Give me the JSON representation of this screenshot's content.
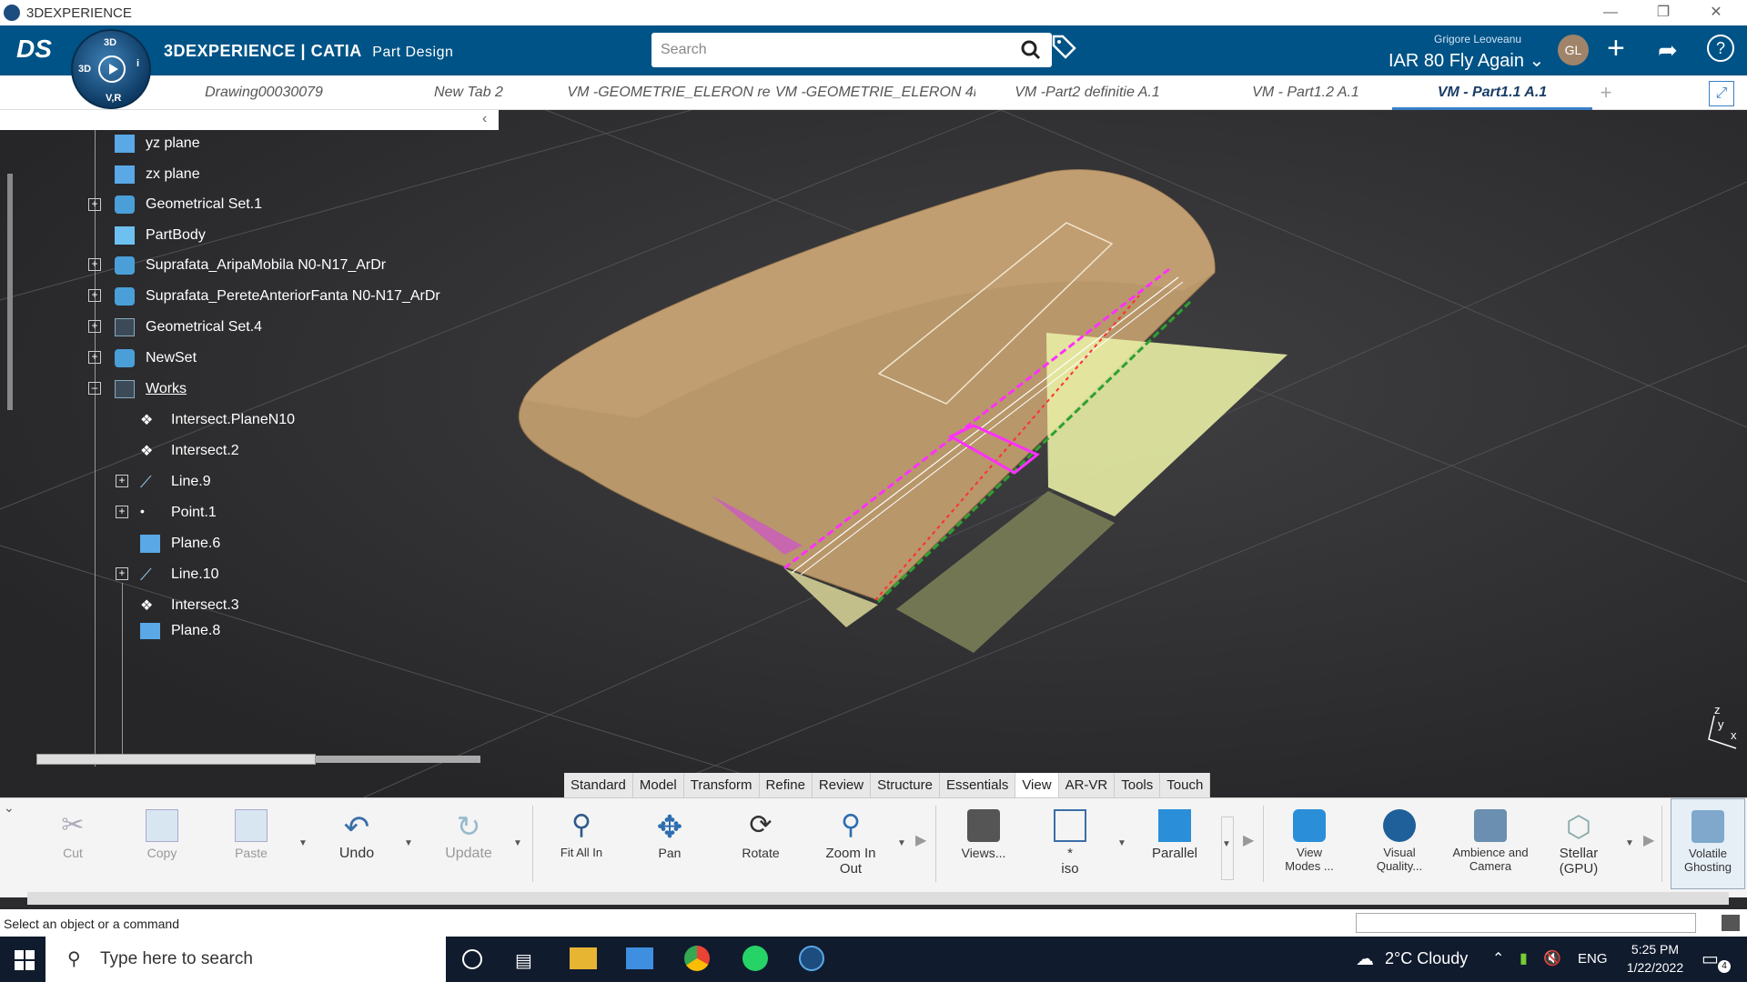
{
  "window": {
    "title": "3DEXPERIENCE"
  },
  "header": {
    "brand": "3DEXPERIENCE | CATIA",
    "app": "Part Design",
    "user_name": "Grigore Leoveanu",
    "project": "IAR 80 Fly Again",
    "avatar": "GL",
    "compass": {
      "top": "3D",
      "bottom": "V,R",
      "right": "i",
      "left": "3D"
    }
  },
  "search": {
    "placeholder": "Search"
  },
  "tabs": [
    {
      "label": "Drawing00030079"
    },
    {
      "label": "New Tab 2"
    },
    {
      "label": "VM -GEOMETRIE_ELERON re"
    },
    {
      "label": "VM -GEOMETRIE_ELERON 4n"
    },
    {
      "label": "VM -Part2 definitie A.1"
    },
    {
      "label": "VM - Part1.2 A.1"
    },
    {
      "label": "VM - Part1.1 A.1"
    },
    {
      "label": "+"
    }
  ],
  "tree": [
    {
      "label": "yz plane",
      "icon": "plane-icon"
    },
    {
      "label": "zx plane",
      "icon": "plane-icon"
    },
    {
      "label": "Geometrical Set.1",
      "icon": "geoset-icon"
    },
    {
      "label": "PartBody",
      "icon": "partbody-icon"
    },
    {
      "label": "Suprafata_AripaMobila N0-N17_ArDr",
      "icon": "geoset-icon"
    },
    {
      "label": "Suprafata_PereteAnteriorFanta N0-N17_ArDr",
      "icon": "geoset-icon"
    },
    {
      "label": "Geometrical Set.4",
      "icon": "geoset-icon"
    },
    {
      "label": "NewSet",
      "icon": "geoset-icon"
    },
    {
      "label": "Works",
      "icon": "geoset-icon"
    },
    {
      "label": "Intersect.PlaneN10",
      "icon": "intersect-icon"
    },
    {
      "label": "Intersect.2",
      "icon": "intersect-icon"
    },
    {
      "label": "Line.9",
      "icon": "line-icon"
    },
    {
      "label": "Point.1",
      "icon": "point-icon"
    },
    {
      "label": "Plane.6",
      "icon": "plane-icon"
    },
    {
      "label": "Line.10",
      "icon": "line-icon"
    },
    {
      "label": "Intersect.3",
      "icon": "intersect-icon"
    },
    {
      "label": "Plane.8",
      "icon": "plane-icon"
    }
  ],
  "tool_tabs": [
    "Standard",
    "Model",
    "Transform",
    "Refine",
    "Review",
    "Structure",
    "Essentials",
    "View",
    "AR-VR",
    "Tools",
    "Touch"
  ],
  "active_tool_tab": "View",
  "toolbar": {
    "cut": "Cut",
    "copy": "Copy",
    "paste": "Paste",
    "undo": "Undo",
    "update": "Update",
    "fit": "Fit All In",
    "pan": "Pan",
    "rotate": "Rotate",
    "zoom": "Zoom In Out",
    "views": "Views...",
    "iso_star": "*",
    "iso": "iso",
    "parallel": "Parallel",
    "view_modes": "View Modes ...",
    "visual_quality": "Visual Quality...",
    "ambience": "Ambience and Camera",
    "stellar": "Stellar (GPU)",
    "volatile": "Volatile Ghosting"
  },
  "compass3d": {
    "z": "z",
    "y": "y",
    "x": "x"
  },
  "status": {
    "message": "Select an object or a command"
  },
  "taskbar": {
    "search_placeholder": "Type here to search",
    "weather": "2°C  Cloudy",
    "lang": "ENG",
    "time": "5:25 PM",
    "date": "1/22/2022",
    "notif": "4"
  },
  "colors": {
    "header": "#005386",
    "wing": "#b8976a",
    "panel": "#e8eda4",
    "magenta": "#e020e0",
    "green": "#2fa030"
  }
}
